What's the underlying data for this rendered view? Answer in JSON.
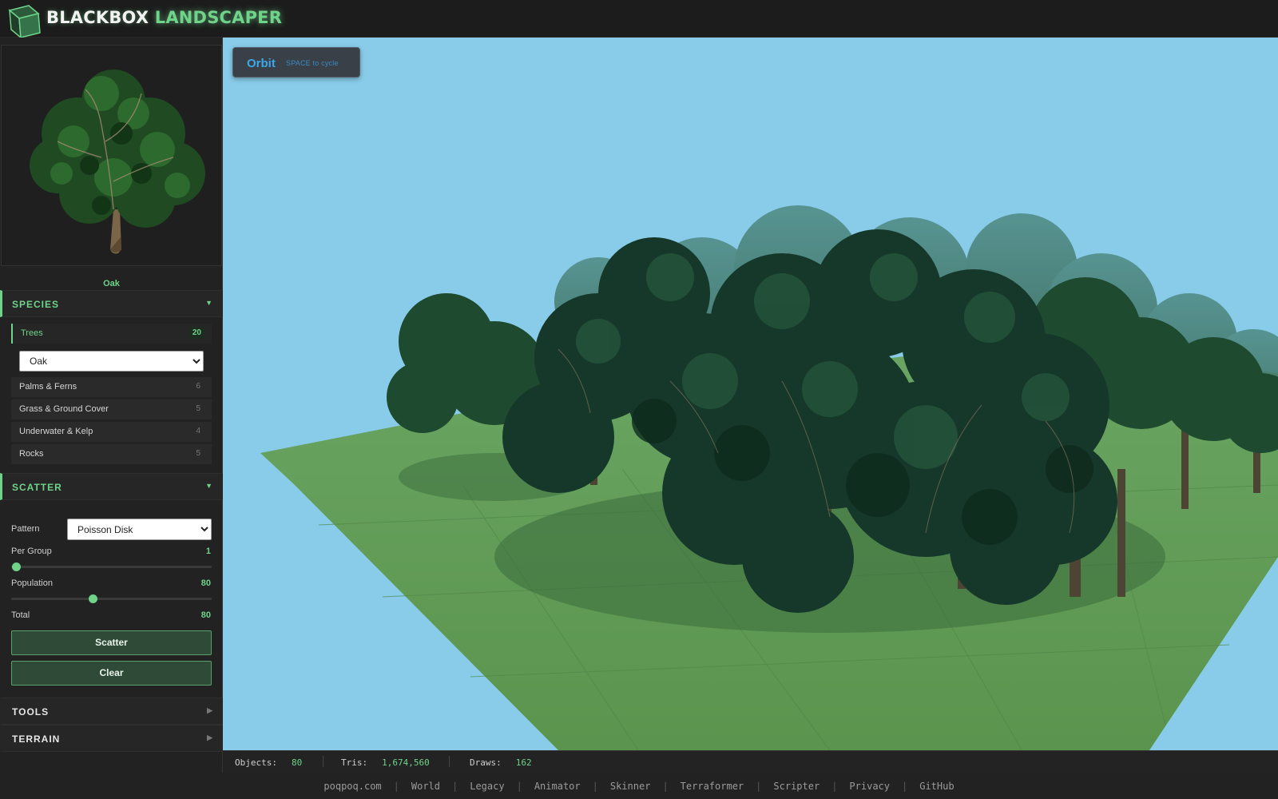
{
  "app": {
    "logo_part1": "BLACKBOX",
    "logo_part2": "LANDSCAPER",
    "accent": "#6fd38a"
  },
  "preview": {
    "name": "Oak"
  },
  "species": {
    "heading": "SPECIES",
    "categories": [
      {
        "label": "Trees",
        "count": "20",
        "active": true
      },
      {
        "label": "Palms & Ferns",
        "count": "6"
      },
      {
        "label": "Grass & Ground Cover",
        "count": "5"
      },
      {
        "label": "Underwater & Kelp",
        "count": "4"
      },
      {
        "label": "Rocks",
        "count": "5"
      }
    ],
    "tree_select": "Oak"
  },
  "scatter": {
    "heading": "SCATTER",
    "pattern_label": "Pattern",
    "pattern_value": "Poisson Disk",
    "per_group_label": "Per Group",
    "per_group_value": "1",
    "per_group_fraction": 0.0,
    "population_label": "Population",
    "population_value": "80",
    "population_fraction": 0.4,
    "total_label": "Total",
    "total_value": "80",
    "scatter_button": "Scatter",
    "clear_button": "Clear"
  },
  "tools": {
    "heading": "TOOLS"
  },
  "terrain": {
    "heading": "TERRAIN"
  },
  "viewport": {
    "mode": "Orbit",
    "mode_hint": "SPACE to cycle",
    "sky_color": "#88ccea",
    "ground_color": "#5d9a52"
  },
  "stats": {
    "objects_label": "Objects:",
    "objects_value": "80",
    "tris_label": "Tris:",
    "tris_value": "1,674,560",
    "draws_label": "Draws:",
    "draws_value": "162"
  },
  "footer": {
    "links": [
      "poqpoq.com",
      "World",
      "Legacy",
      "Animator",
      "Skinner",
      "Terraformer",
      "Scripter",
      "Privacy",
      "GitHub"
    ],
    "separator": "|"
  }
}
